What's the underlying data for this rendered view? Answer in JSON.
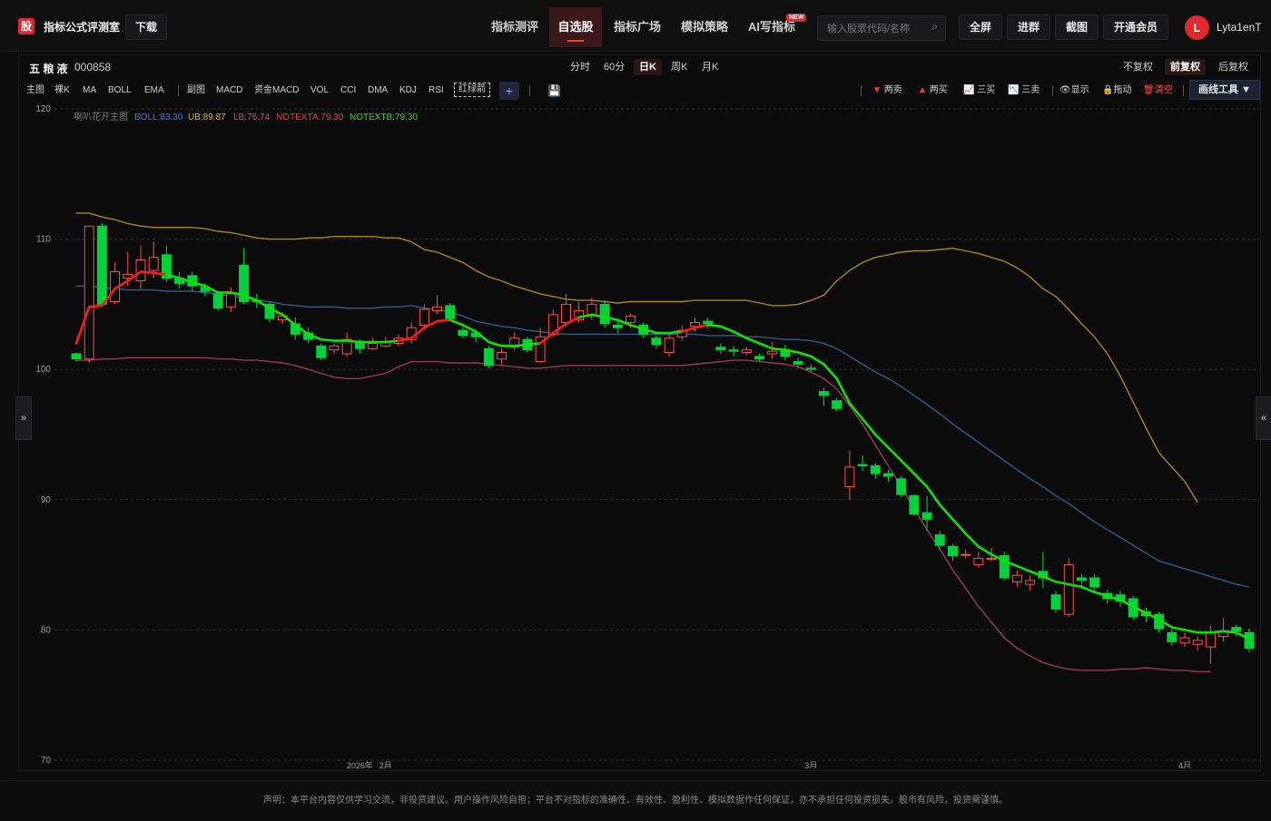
{
  "app": {
    "logo_char": "股",
    "title": "指标公式评测室",
    "download": "下载"
  },
  "nav": [
    {
      "label": "指标测评",
      "x": 541
    },
    {
      "label": "自选股",
      "active": true
    },
    {
      "label": "指标广场"
    },
    {
      "label": "模拟策略"
    },
    {
      "label": "AI写指标"
    }
  ],
  "new_badge": "NEW",
  "search": {
    "placeholder": "输入股票代码/名称"
  },
  "top_buttons": [
    "全屏",
    "进群",
    "截图",
    "开通会员"
  ],
  "user": {
    "avatar": "L",
    "name": "Lyta1enT"
  },
  "stock": {
    "name": "五 粮 液",
    "code": "000858"
  },
  "periods": [
    "分时",
    "60分",
    "日K",
    "周K",
    "月K"
  ],
  "active_period": "日K",
  "fuquan": [
    "不复权",
    "前复权",
    "后复权"
  ],
  "active_fuquan": "前复权",
  "toolbar_left": [
    "主图",
    "裸K",
    "MA",
    "BOLL",
    "EMA",
    "副图",
    "MACD",
    "资金MACD",
    "VOL",
    "CCI",
    "DMA",
    "KDJ",
    "RSI",
    "红绿箭"
  ],
  "toolbar_right": {
    "sell2": "两卖",
    "buy2": "两买",
    "buy3": "三买",
    "sell3": "三卖",
    "show": "显示",
    "drag": "拖动",
    "clear": "清空",
    "draw": "画线工具 ▼"
  },
  "legend": {
    "main": "喇叭花开主图",
    "boll": "BOLL:83.30",
    "ub": "UB:89.87",
    "lb": "LB:76.74",
    "notexta": "NOTEXTA:79.30",
    "notextb": "NOTEXTB:79.30"
  },
  "colors": {
    "up": "#ff4d4f",
    "down": "#00d23c",
    "boll": "#2f5d8a",
    "ub": "#a8871b",
    "lb": "#9c3a55",
    "ma_red": "#ff1a1a",
    "ma_green": "#11e000"
  },
  "chart_data": {
    "type": "candlestick",
    "ylim": [
      70,
      120
    ],
    "yticks": [
      70,
      80,
      90,
      100,
      110,
      120
    ],
    "x_labels": [
      {
        "index": 22,
        "label": "2026年"
      },
      {
        "index": 24,
        "label": "2月"
      },
      {
        "index": 57,
        "label": "3月"
      },
      {
        "index": 86,
        "label": "4月"
      }
    ],
    "candles": [
      [
        101.2,
        100.8,
        101.3,
        100.6
      ],
      [
        100.8,
        111.0,
        111.0,
        100.5
      ],
      [
        111.0,
        105.0,
        111.2,
        104.8
      ],
      [
        105.2,
        107.5,
        108.2,
        105.0
      ],
      [
        107.0,
        107.3,
        109.0,
        106.4
      ],
      [
        106.8,
        108.4,
        109.5,
        106.2
      ],
      [
        107.6,
        108.6,
        109.8,
        107.0
      ],
      [
        108.8,
        107.0,
        109.5,
        106.7
      ],
      [
        107.0,
        106.6,
        107.5,
        106.2
      ],
      [
        107.2,
        106.4,
        107.5,
        106.0
      ],
      [
        106.3,
        106.0,
        106.6,
        105.6
      ],
      [
        105.8,
        104.7,
        106.0,
        104.5
      ],
      [
        104.8,
        105.8,
        106.3,
        104.4
      ],
      [
        108.0,
        105.2,
        109.3,
        105.0
      ],
      [
        105.3,
        105.2,
        105.8,
        104.7
      ],
      [
        105.0,
        103.9,
        105.2,
        103.6
      ],
      [
        103.8,
        104.1,
        104.4,
        103.5
      ],
      [
        103.5,
        102.7,
        104.0,
        102.3
      ],
      [
        102.8,
        102.3,
        103.2,
        102.0
      ],
      [
        101.8,
        100.9,
        102.0,
        100.7
      ],
      [
        101.5,
        101.8,
        102.0,
        101.2
      ],
      [
        101.2,
        102.3,
        102.8,
        101.0
      ],
      [
        102.0,
        101.6,
        102.3,
        101.2
      ],
      [
        101.6,
        102.0,
        102.4,
        101.5
      ],
      [
        101.8,
        102.1,
        102.5,
        101.7
      ],
      [
        102.0,
        102.4,
        102.7,
        101.8
      ],
      [
        102.3,
        103.2,
        103.6,
        102.0
      ],
      [
        103.4,
        104.6,
        105.0,
        103.0
      ],
      [
        104.5,
        104.8,
        105.7,
        104.2
      ],
      [
        104.9,
        103.9,
        105.1,
        103.7
      ],
      [
        103.0,
        102.6,
        103.3,
        102.4
      ],
      [
        102.8,
        102.5,
        103.0,
        102.1
      ],
      [
        101.6,
        100.3,
        101.8,
        100.1
      ],
      [
        100.8,
        101.3,
        101.6,
        100.4
      ],
      [
        101.7,
        102.4,
        102.8,
        101.5
      ],
      [
        102.3,
        101.5,
        102.5,
        101.3
      ],
      [
        100.6,
        102.5,
        103.2,
        100.5
      ],
      [
        102.7,
        104.2,
        104.6,
        102.5
      ],
      [
        103.6,
        105.0,
        105.8,
        103.3
      ],
      [
        103.8,
        104.5,
        105.2,
        103.6
      ],
      [
        104.1,
        105.0,
        105.5,
        103.8
      ],
      [
        105.0,
        103.5,
        105.3,
        103.2
      ],
      [
        103.4,
        103.2,
        103.9,
        102.8
      ],
      [
        103.6,
        104.1,
        104.3,
        103.2
      ],
      [
        103.4,
        102.7,
        103.6,
        102.4
      ],
      [
        102.4,
        101.9,
        102.6,
        101.6
      ],
      [
        101.3,
        102.4,
        102.7,
        101.0
      ],
      [
        102.5,
        103.0,
        103.4,
        102.2
      ],
      [
        103.3,
        103.6,
        104.0,
        102.9
      ],
      [
        103.7,
        103.5,
        104.0,
        103.1
      ],
      [
        101.7,
        101.5,
        102.0,
        101.2
      ],
      [
        101.5,
        101.4,
        101.8,
        101.0
      ],
      [
        101.3,
        101.5,
        101.7,
        101.1
      ],
      [
        101.0,
        100.8,
        101.2,
        100.6
      ],
      [
        101.2,
        101.4,
        102.1,
        100.8
      ],
      [
        101.5,
        101.0,
        101.9,
        100.7
      ],
      [
        100.6,
        100.4,
        100.9,
        100.1
      ],
      [
        100.1,
        100.0,
        100.4,
        99.8
      ],
      [
        98.3,
        98.0,
        98.6,
        97.2
      ],
      [
        97.6,
        97.0,
        97.8,
        96.8
      ],
      [
        91.0,
        92.5,
        93.8,
        90.0
      ],
      [
        92.7,
        92.6,
        93.4,
        92.2
      ],
      [
        92.6,
        92.0,
        92.8,
        91.6
      ],
      [
        92.0,
        91.8,
        92.3,
        91.4
      ],
      [
        91.6,
        90.4,
        91.8,
        90.2
      ],
      [
        90.3,
        88.9,
        90.4,
        88.8
      ],
      [
        89.0,
        88.5,
        90.3,
        87.6
      ],
      [
        87.3,
        86.5,
        87.6,
        86.1
      ],
      [
        86.4,
        85.7,
        86.6,
        85.3
      ],
      [
        85.8,
        85.8,
        86.2,
        85.5
      ],
      [
        85.0,
        85.5,
        86.0,
        84.8
      ],
      [
        85.5,
        85.5,
        86.3,
        85.3
      ],
      [
        85.7,
        84.0,
        86.0,
        83.8
      ],
      [
        83.7,
        84.2,
        84.6,
        83.3
      ],
      [
        83.5,
        83.8,
        84.2,
        83.0
      ],
      [
        84.5,
        84.0,
        86.0,
        83.2
      ],
      [
        82.7,
        81.6,
        83.0,
        81.3
      ],
      [
        81.2,
        85.0,
        85.5,
        81.0
      ],
      [
        84.0,
        83.8,
        84.3,
        83.3
      ],
      [
        84.0,
        83.3,
        84.3,
        82.8
      ],
      [
        82.8,
        82.4,
        83.1,
        82.0
      ],
      [
        82.7,
        82.2,
        83.0,
        81.8
      ],
      [
        82.4,
        81.0,
        82.6,
        80.8
      ],
      [
        81.4,
        81.1,
        81.7,
        80.6
      ],
      [
        81.2,
        80.1,
        81.4,
        79.8
      ],
      [
        79.8,
        79.1,
        80.0,
        78.8
      ],
      [
        79.0,
        79.4,
        79.8,
        78.7
      ],
      [
        78.9,
        79.2,
        79.5,
        78.4
      ],
      [
        78.7,
        79.8,
        80.3,
        77.4
      ],
      [
        79.5,
        79.9,
        80.9,
        79.1
      ],
      [
        80.2,
        79.9,
        80.4,
        79.5
      ],
      [
        79.8,
        78.6,
        80.1,
        78.3
      ]
    ],
    "ub_line": [
      112.0,
      112.0,
      111.7,
      111.5,
      111.2,
      111.0,
      110.9,
      110.9,
      110.9,
      110.9,
      110.8,
      110.6,
      110.5,
      110.3,
      110.1,
      110.0,
      110.0,
      110.0,
      110.1,
      110.1,
      110.2,
      110.2,
      110.2,
      110.2,
      110.1,
      110.1,
      109.8,
      109.2,
      109.0,
      108.6,
      108.2,
      107.6,
      107.1,
      106.8,
      106.4,
      106.1,
      105.8,
      105.6,
      105.4,
      105.3,
      105.3,
      105.2,
      105.1,
      105.2,
      105.2,
      105.2,
      105.2,
      105.2,
      105.3,
      105.3,
      105.3,
      105.3,
      105.3,
      105.1,
      104.9,
      104.9,
      105.0,
      105.3,
      105.7,
      106.8,
      107.6,
      108.2,
      108.6,
      108.8,
      109.0,
      109.1,
      109.1,
      109.2,
      109.3,
      109.1,
      108.9,
      108.6,
      108.3,
      107.8,
      107.1,
      106.2,
      105.6,
      104.6,
      103.5,
      102.5,
      101.2,
      99.5,
      97.5,
      95.5,
      93.6,
      92.5,
      91.4,
      89.8
    ],
    "boll_line": [
      106.4,
      106.4,
      106.3,
      106.2,
      106.1,
      106.1,
      106.1,
      106.0,
      106.0,
      106.0,
      105.9,
      105.8,
      105.6,
      105.5,
      105.3,
      105.2,
      105.0,
      104.9,
      104.8,
      104.8,
      104.8,
      104.7,
      104.7,
      104.7,
      104.8,
      104.8,
      104.9,
      104.7,
      104.6,
      104.4,
      104.1,
      103.7,
      103.5,
      103.3,
      103.2,
      103.0,
      102.9,
      102.8,
      102.7,
      102.7,
      102.7,
      102.7,
      102.7,
      102.7,
      102.7,
      102.7,
      102.7,
      102.7,
      102.7,
      102.6,
      102.6,
      102.6,
      102.5,
      102.5,
      102.4,
      102.3,
      102.3,
      102.2,
      102.0,
      101.6,
      101.0,
      100.4,
      99.8,
      99.3,
      98.7,
      98.0,
      97.3,
      96.6,
      95.8,
      95.1,
      94.4,
      93.7,
      93.0,
      92.3,
      91.6,
      91.0,
      90.3,
      89.7,
      89.0,
      88.3,
      87.7,
      87.1,
      86.5,
      85.9,
      85.3,
      85.0,
      84.7,
      84.4,
      84.1,
      83.8,
      83.5,
      83.3
    ],
    "lb_line": [
      100.7,
      100.7,
      100.8,
      100.8,
      100.9,
      100.9,
      100.9,
      100.9,
      100.9,
      100.9,
      100.9,
      100.8,
      100.8,
      100.7,
      100.7,
      100.6,
      100.5,
      100.3,
      100.0,
      99.7,
      99.4,
      99.3,
      99.3,
      99.5,
      99.7,
      100.2,
      100.6,
      100.6,
      100.6,
      100.5,
      100.5,
      100.5,
      100.4,
      100.3,
      100.2,
      100.1,
      100.1,
      100.2,
      100.3,
      100.3,
      100.3,
      100.3,
      100.3,
      100.3,
      100.3,
      100.3,
      100.3,
      100.3,
      100.4,
      100.5,
      100.6,
      100.7,
      100.7,
      100.6,
      100.5,
      100.4,
      100.2,
      99.8,
      99.3,
      98.5,
      97.2,
      95.8,
      94.2,
      92.6,
      91.0,
      89.3,
      87.7,
      86.2,
      84.6,
      83.2,
      81.8,
      80.6,
      79.4,
      78.6,
      78.0,
      77.5,
      77.2,
      77.0,
      76.9,
      76.9,
      76.9,
      77.0,
      77.0,
      77.1,
      77.0,
      76.9,
      76.9,
      76.8,
      76.8
    ],
    "main_line": [
      102.0,
      104.8,
      104.9,
      106.2,
      106.8,
      107.5,
      107.4,
      107.3,
      107.0,
      106.7,
      106.4,
      105.9,
      105.9,
      105.7,
      105.3,
      104.7,
      104.2,
      103.4,
      102.7,
      102.3,
      102.2,
      102.2,
      102.1,
      102.1,
      102.1,
      102.2,
      102.4,
      103.2,
      103.7,
      103.8,
      103.4,
      102.9,
      102.1,
      101.8,
      101.8,
      101.9,
      102.0,
      102.8,
      103.5,
      104.0,
      104.2,
      104.0,
      103.8,
      103.4,
      103.1,
      102.8,
      102.8,
      102.9,
      103.2,
      103.4,
      103.3,
      102.9,
      102.4,
      102.0,
      101.6,
      101.5,
      101.3,
      101.0,
      100.4,
      99.3,
      97.4,
      96.2,
      95.0,
      94.0,
      93.0,
      92.0,
      91.0,
      89.6,
      88.5,
      87.4,
      86.4,
      85.8,
      85.3,
      84.9,
      84.5,
      84.1,
      83.7,
      83.5,
      83.3,
      82.9,
      82.6,
      82.3,
      81.8,
      81.3,
      80.8,
      80.2,
      80.0,
      79.8,
      79.8,
      79.9,
      79.8,
      79.3
    ],
    "main_line_colors": [
      "red",
      "red",
      "red",
      "red",
      "red",
      "red",
      "red",
      "green",
      "green",
      "green",
      "green",
      "green",
      "green",
      "green",
      "green",
      "green",
      "green",
      "green",
      "green",
      "green",
      "green",
      "green",
      "green",
      "green",
      "green",
      "red",
      "red",
      "red",
      "red",
      "green",
      "green",
      "green",
      "green",
      "green",
      "green",
      "green",
      "red",
      "red",
      "red",
      "green",
      "green",
      "green",
      "green",
      "green",
      "green",
      "green",
      "green",
      "red",
      "red",
      "green",
      "green",
      "green",
      "green",
      "green",
      "green",
      "green",
      "green",
      "green",
      "green",
      "green",
      "green",
      "green",
      "green",
      "green",
      "green",
      "green",
      "green",
      "green",
      "green",
      "green",
      "green",
      "green",
      "green",
      "green",
      "green",
      "green",
      "green",
      "green",
      "green",
      "green",
      "green",
      "green",
      "green",
      "green",
      "green",
      "green",
      "green",
      "green",
      "green",
      "green",
      "green"
    ]
  },
  "footer": "声明：本平台内容仅供学习交流，非投资建议。用户操作风险自担；平台不对指标的准确性、有效性、盈利性、模拟数据作任何保证，亦不承担任何投资损失。股市有风险，投资需谨慎。"
}
